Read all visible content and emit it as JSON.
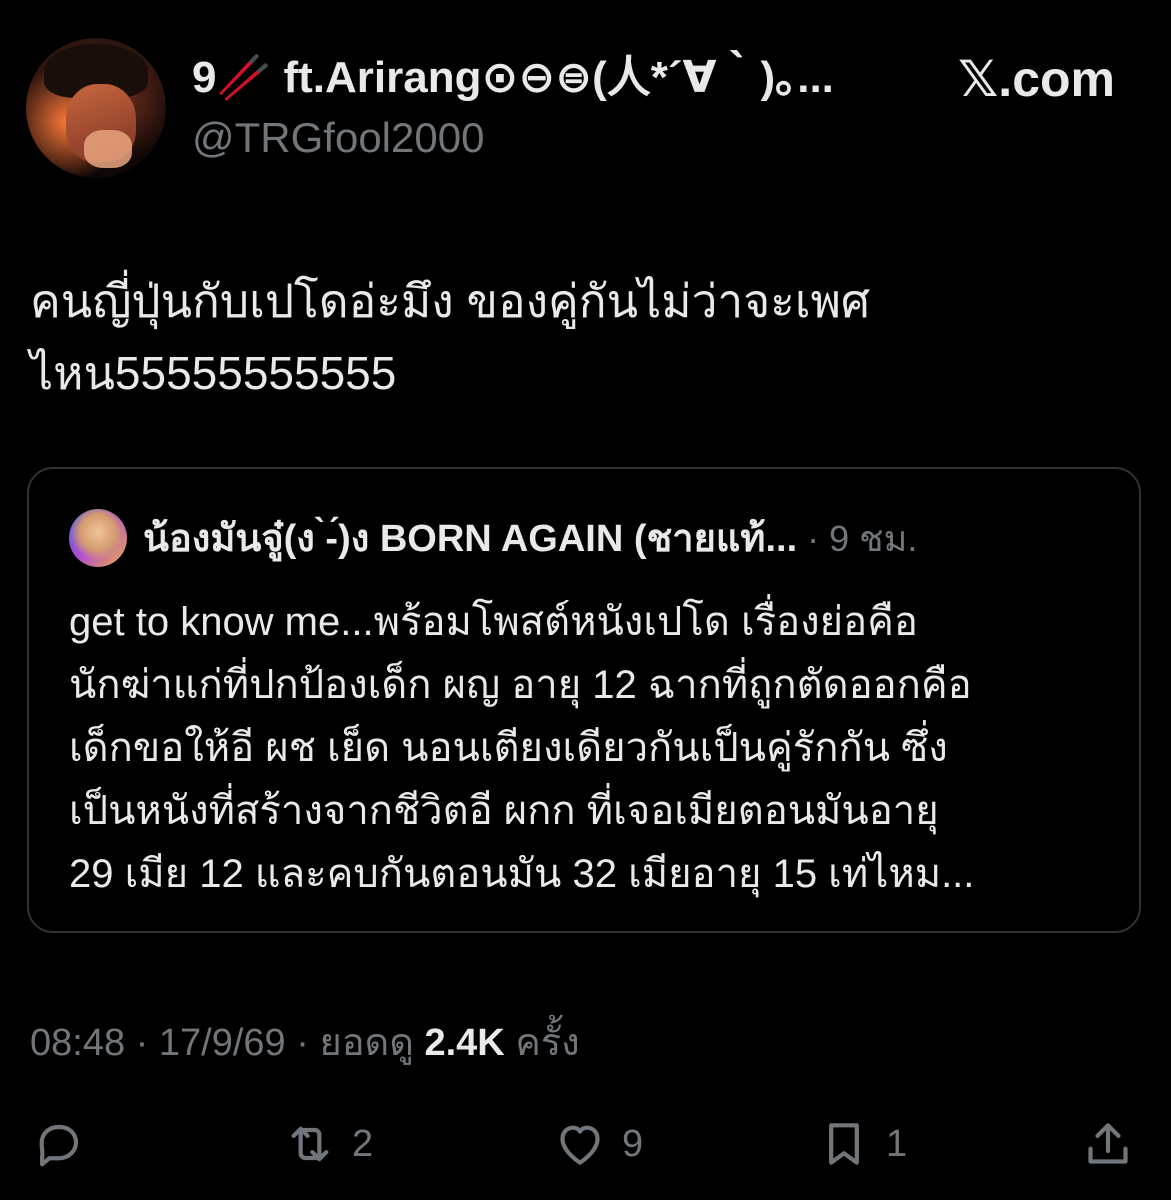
{
  "author": {
    "display_name": "9🥢 ft.Arirang⊙⊖⊜(人*´∀｀)｡...",
    "handle": "@TRGfool2000",
    "avatar": "profile-photo"
  },
  "site_brand": "𝕏.com",
  "post": {
    "text_lines": [
      "คนญี่ปุ่นกับเปโดอ่ะมึง ของคู่กันไม่ว่าจะเพศ",
      "ไหน55555555555"
    ]
  },
  "quoted_post": {
    "author_name": "น้องมันจู๋(ง ̀-́)ง BORN AGAIN (ชายแท้...",
    "meta": "· 9 ชม.",
    "text_lines": [
      "get to know me...พร้อมโพสต์หนังเปโด เรื่องย่อคือ",
      "นักฆ่าแก่ที่ปกป้องเด็ก ผญ อายุ 12 ฉากที่ถูกตัดออกคือ",
      "เด็กขอให้อี ผช เย็ด นอนเตียงเดียวกันเป็นคู่รักกัน ซึ่ง",
      "เป็นหนังที่สร้างจากชีวิตอี ผกก ที่เจอเมียตอนมันอายุ",
      "29 เมีย 12 และคบกันตอนมัน 32 เมียอายุ 15 เท่ไหม..."
    ]
  },
  "meta_line": {
    "time": "08:48",
    "sep1": " · ",
    "date": "17/9/69",
    "sep2": " · ",
    "views_label": "ยอดดู",
    "views_count": "2.4K",
    "views_suffix": "ครั้ง"
  },
  "actions": {
    "reply": {
      "icon": "reply-icon",
      "count": ""
    },
    "repost": {
      "icon": "repost-icon",
      "count": "2"
    },
    "like": {
      "icon": "heart-icon",
      "count": "9"
    },
    "bookmark": {
      "icon": "bookmark-icon",
      "count": "1"
    },
    "share": {
      "icon": "share-icon",
      "count": ""
    }
  },
  "colors": {
    "background": "#000000",
    "text_primary": "#e7e9ea",
    "text_secondary": "#71767b",
    "border": "#2f3336"
  }
}
